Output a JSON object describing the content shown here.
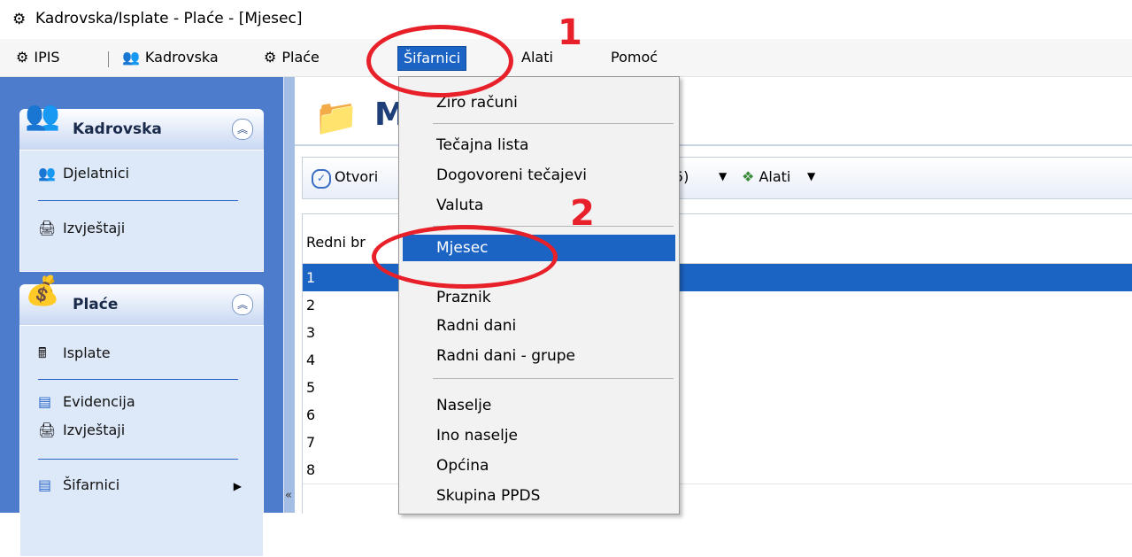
{
  "window": {
    "title": "Kadrovska/Isplate - Plaće - [Mjesec]",
    "icon": "app-gear-icon"
  },
  "menubar": {
    "items": [
      {
        "label": "IPIS",
        "icon": "gear-icon"
      },
      {
        "label": "Kadrovska",
        "icon": "people-icon"
      },
      {
        "label": "Plaće",
        "icon": "gear-icon"
      },
      {
        "label": "Šifarnici"
      },
      {
        "label": "Alati"
      },
      {
        "label": "Pomoć"
      }
    ]
  },
  "sidebar": {
    "groups": [
      {
        "label": "Kadrovska",
        "icon": "people-icon",
        "items": [
          {
            "label": "Djelatnici",
            "icon": "people-icon"
          },
          {
            "label": "Izvještaji",
            "icon": "printer-icon"
          }
        ]
      },
      {
        "label": "Plaće",
        "icon": "coins-icon",
        "items": [
          {
            "label": "Isplate",
            "icon": "calculator-icon"
          },
          {
            "label": "Evidencija",
            "icon": "table-icon"
          },
          {
            "label": "Izvještaji",
            "icon": "printer-icon"
          },
          {
            "label": "Šifarnici",
            "icon": "table-icon"
          }
        ]
      }
    ]
  },
  "main": {
    "header_title": "M",
    "toolbar": {
      "open_label": "Otvori",
      "count_label": "5)",
      "tools_label": "Alati"
    },
    "grid": {
      "header": "Redni br",
      "rows": [
        "1",
        "2",
        "3",
        "4",
        "5",
        "6",
        "7",
        "8"
      ],
      "selected_row": 0
    }
  },
  "dropdown": {
    "items": [
      "Žiro računi",
      "Tečajna lista",
      "Dogovoreni tečajevi",
      "Valuta",
      "Mjesec",
      "Praznik",
      "Radni dani",
      "Radni dani - grupe",
      "Naselje",
      "Ino naselje",
      "Općina",
      "Skupina PPDS"
    ],
    "highlighted": "Mjesec"
  },
  "annotations": {
    "step1": "1",
    "step2": "2",
    "color": "#e8202a"
  },
  "colors": {
    "accent": "#1c64c4",
    "sidebar": "#4d7ccd"
  }
}
